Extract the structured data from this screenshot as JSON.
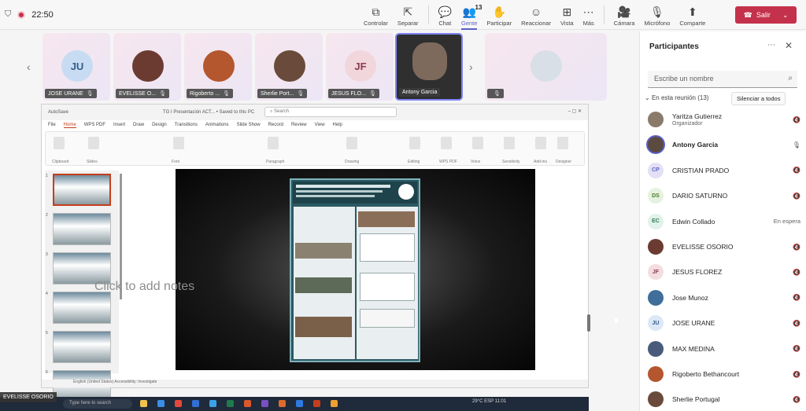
{
  "top": {
    "timer": "22:50",
    "buttons": [
      {
        "label": "Controlar",
        "icon": "⧉"
      },
      {
        "label": "Separar",
        "icon": "⇱"
      },
      {
        "label": "Chat",
        "icon": "💬"
      },
      {
        "label": "Gente",
        "icon": "👥",
        "badge": "13"
      },
      {
        "label": "Participar",
        "icon": "✋"
      },
      {
        "label": "Reaccionar",
        "icon": "☺"
      },
      {
        "label": "Vista",
        "icon": "⊞"
      },
      {
        "label": "Más",
        "icon": "⋯"
      },
      {
        "label": "Cámara",
        "icon": "🎥"
      },
      {
        "label": "Micrófono",
        "icon": "🎙"
      },
      {
        "label": "Comparte",
        "icon": "⬆"
      }
    ],
    "leave_label": "Salir",
    "colors": {
      "accent": "#5b5fc7",
      "leave": "#c4314b"
    }
  },
  "tiles": [
    {
      "initials": "JU",
      "name": "JOSE URANE",
      "bg": "#c7dcf2",
      "fg": "#345d8a"
    },
    {
      "initials": "",
      "name": "EVELISSE O...",
      "bg": "#6b3b32",
      "fg": "#fff"
    },
    {
      "initials": "",
      "name": "Rigoberto ...",
      "bg": "#b4562e",
      "fg": "#fff"
    },
    {
      "initials": "",
      "name": "Sherlie Port...",
      "bg": "#6a4a3a",
      "fg": "#fff"
    },
    {
      "initials": "JF",
      "name": "JESUS FLO...",
      "bg": "#f1d6dc",
      "fg": "#8a3b4f"
    },
    {
      "initials": "",
      "name": "Antony Garcia",
      "bg": "#7d6a5d",
      "fg": "#fff"
    },
    {
      "initials": "",
      "name": "",
      "bg": "#d8dfe6",
      "fg": "#345d8a"
    }
  ],
  "ppt": {
    "autosave": "AutoSave",
    "title": "TG I Presentación ACT... • Saved to this PC",
    "search": "Search",
    "tabs": [
      "File",
      "Home",
      "WPS PDF",
      "Insert",
      "Draw",
      "Design",
      "Transitions",
      "Animations",
      "Slide Show",
      "Record",
      "Review",
      "View",
      "Help"
    ],
    "ribbon_groups": [
      "Clipboard",
      "Slides",
      "Font",
      "Paragraph",
      "Drawing",
      "Editing",
      "WPS PDF",
      "Voice",
      "Sensitivity",
      "Add-ins",
      "Designer"
    ],
    "thumb_numbers": [
      "1",
      "2",
      "3",
      "4",
      "5",
      "6"
    ],
    "notes_hint": "Click to add notes",
    "status": "English (United States)   Accessibility: Investigate"
  },
  "taskbar": {
    "presenter_name": "EVELISSE OSORIO",
    "search": "Type here to search",
    "tray": "29°C   ESP   11:01"
  },
  "panel": {
    "title": "Participantes",
    "search_placeholder": "Escribe un nombre",
    "in_meeting": "En esta reunión (13)",
    "mute_all": "Silenciar a todos",
    "participants": [
      {
        "initials": "",
        "name": "Yaritza Gutierrez",
        "role": "Organizador",
        "status": "muted",
        "bg": "#8a7a6a",
        "fg": "#fff"
      },
      {
        "initials": "",
        "name": "Antony Garcia",
        "role": "",
        "status": "speaking",
        "bg": "#5a4a3f",
        "fg": "#fff"
      },
      {
        "initials": "CP",
        "name": "CRISTIAN PRADO",
        "role": "",
        "status": "muted",
        "bg": "#e3e0f5",
        "fg": "#5b5fc7"
      },
      {
        "initials": "DS",
        "name": "DARIO SATURNO",
        "role": "",
        "status": "muted",
        "bg": "#e6f2df",
        "fg": "#4b7a2f"
      },
      {
        "initials": "EC",
        "name": "Edwin Collado",
        "role": "",
        "status": "En espera",
        "bg": "#e0f2ea",
        "fg": "#2f7a56"
      },
      {
        "initials": "",
        "name": "EVELISSE OSORIO",
        "role": "",
        "status": "muted",
        "bg": "#6b3b32",
        "fg": "#fff"
      },
      {
        "initials": "JF",
        "name": "JESUS FLOREZ",
        "role": "",
        "status": "muted",
        "bg": "#f4dde2",
        "fg": "#8a3b4f"
      },
      {
        "initials": "",
        "name": "Jose Munoz",
        "role": "",
        "status": "muted",
        "bg": "#3f6e9a",
        "fg": "#fff"
      },
      {
        "initials": "JU",
        "name": "JOSE URANE",
        "role": "",
        "status": "muted",
        "bg": "#dce8f5",
        "fg": "#345d8a"
      },
      {
        "initials": "",
        "name": "MAX MEDINA",
        "role": "",
        "status": "muted",
        "bg": "#4a5a7a",
        "fg": "#fff"
      },
      {
        "initials": "",
        "name": "Rigoberto Bethancourt",
        "role": "",
        "status": "muted",
        "bg": "#b4562e",
        "fg": "#fff"
      },
      {
        "initials": "",
        "name": "Sherlie Portugal",
        "role": "",
        "status": "muted",
        "bg": "#6a4a3a",
        "fg": "#fff"
      }
    ]
  }
}
